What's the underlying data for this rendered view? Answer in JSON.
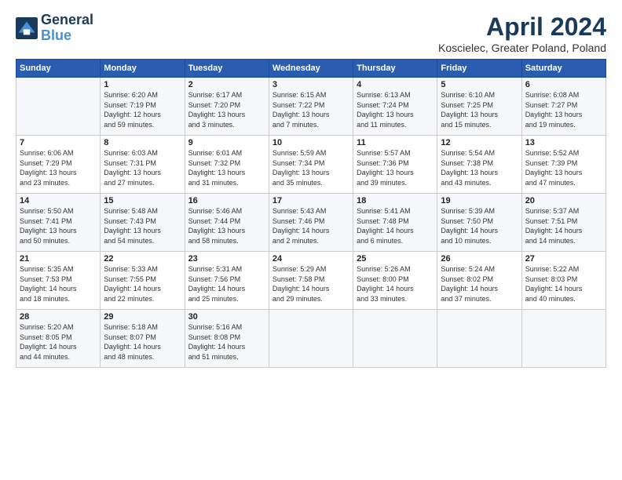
{
  "header": {
    "logo_line1": "General",
    "logo_line2": "Blue",
    "title": "April 2024",
    "location": "Koscielec, Greater Poland, Poland"
  },
  "columns": [
    "Sunday",
    "Monday",
    "Tuesday",
    "Wednesday",
    "Thursday",
    "Friday",
    "Saturday"
  ],
  "weeks": [
    [
      {
        "day": "",
        "text": ""
      },
      {
        "day": "1",
        "text": "Sunrise: 6:20 AM\nSunset: 7:19 PM\nDaylight: 12 hours\nand 59 minutes."
      },
      {
        "day": "2",
        "text": "Sunrise: 6:17 AM\nSunset: 7:20 PM\nDaylight: 13 hours\nand 3 minutes."
      },
      {
        "day": "3",
        "text": "Sunrise: 6:15 AM\nSunset: 7:22 PM\nDaylight: 13 hours\nand 7 minutes."
      },
      {
        "day": "4",
        "text": "Sunrise: 6:13 AM\nSunset: 7:24 PM\nDaylight: 13 hours\nand 11 minutes."
      },
      {
        "day": "5",
        "text": "Sunrise: 6:10 AM\nSunset: 7:25 PM\nDaylight: 13 hours\nand 15 minutes."
      },
      {
        "day": "6",
        "text": "Sunrise: 6:08 AM\nSunset: 7:27 PM\nDaylight: 13 hours\nand 19 minutes."
      }
    ],
    [
      {
        "day": "7",
        "text": "Sunrise: 6:06 AM\nSunset: 7:29 PM\nDaylight: 13 hours\nand 23 minutes."
      },
      {
        "day": "8",
        "text": "Sunrise: 6:03 AM\nSunset: 7:31 PM\nDaylight: 13 hours\nand 27 minutes."
      },
      {
        "day": "9",
        "text": "Sunrise: 6:01 AM\nSunset: 7:32 PM\nDaylight: 13 hours\nand 31 minutes."
      },
      {
        "day": "10",
        "text": "Sunrise: 5:59 AM\nSunset: 7:34 PM\nDaylight: 13 hours\nand 35 minutes."
      },
      {
        "day": "11",
        "text": "Sunrise: 5:57 AM\nSunset: 7:36 PM\nDaylight: 13 hours\nand 39 minutes."
      },
      {
        "day": "12",
        "text": "Sunrise: 5:54 AM\nSunset: 7:38 PM\nDaylight: 13 hours\nand 43 minutes."
      },
      {
        "day": "13",
        "text": "Sunrise: 5:52 AM\nSunset: 7:39 PM\nDaylight: 13 hours\nand 47 minutes."
      }
    ],
    [
      {
        "day": "14",
        "text": "Sunrise: 5:50 AM\nSunset: 7:41 PM\nDaylight: 13 hours\nand 50 minutes."
      },
      {
        "day": "15",
        "text": "Sunrise: 5:48 AM\nSunset: 7:43 PM\nDaylight: 13 hours\nand 54 minutes."
      },
      {
        "day": "16",
        "text": "Sunrise: 5:46 AM\nSunset: 7:44 PM\nDaylight: 13 hours\nand 58 minutes."
      },
      {
        "day": "17",
        "text": "Sunrise: 5:43 AM\nSunset: 7:46 PM\nDaylight: 14 hours\nand 2 minutes."
      },
      {
        "day": "18",
        "text": "Sunrise: 5:41 AM\nSunset: 7:48 PM\nDaylight: 14 hours\nand 6 minutes."
      },
      {
        "day": "19",
        "text": "Sunrise: 5:39 AM\nSunset: 7:50 PM\nDaylight: 14 hours\nand 10 minutes."
      },
      {
        "day": "20",
        "text": "Sunrise: 5:37 AM\nSunset: 7:51 PM\nDaylight: 14 hours\nand 14 minutes."
      }
    ],
    [
      {
        "day": "21",
        "text": "Sunrise: 5:35 AM\nSunset: 7:53 PM\nDaylight: 14 hours\nand 18 minutes."
      },
      {
        "day": "22",
        "text": "Sunrise: 5:33 AM\nSunset: 7:55 PM\nDaylight: 14 hours\nand 22 minutes."
      },
      {
        "day": "23",
        "text": "Sunrise: 5:31 AM\nSunset: 7:56 PM\nDaylight: 14 hours\nand 25 minutes."
      },
      {
        "day": "24",
        "text": "Sunrise: 5:29 AM\nSunset: 7:58 PM\nDaylight: 14 hours\nand 29 minutes."
      },
      {
        "day": "25",
        "text": "Sunrise: 5:26 AM\nSunset: 8:00 PM\nDaylight: 14 hours\nand 33 minutes."
      },
      {
        "day": "26",
        "text": "Sunrise: 5:24 AM\nSunset: 8:02 PM\nDaylight: 14 hours\nand 37 minutes."
      },
      {
        "day": "27",
        "text": "Sunrise: 5:22 AM\nSunset: 8:03 PM\nDaylight: 14 hours\nand 40 minutes."
      }
    ],
    [
      {
        "day": "28",
        "text": "Sunrise: 5:20 AM\nSunset: 8:05 PM\nDaylight: 14 hours\nand 44 minutes."
      },
      {
        "day": "29",
        "text": "Sunrise: 5:18 AM\nSunset: 8:07 PM\nDaylight: 14 hours\nand 48 minutes."
      },
      {
        "day": "30",
        "text": "Sunrise: 5:16 AM\nSunset: 8:08 PM\nDaylight: 14 hours\nand 51 minutes."
      },
      {
        "day": "",
        "text": ""
      },
      {
        "day": "",
        "text": ""
      },
      {
        "day": "",
        "text": ""
      },
      {
        "day": "",
        "text": ""
      }
    ]
  ]
}
